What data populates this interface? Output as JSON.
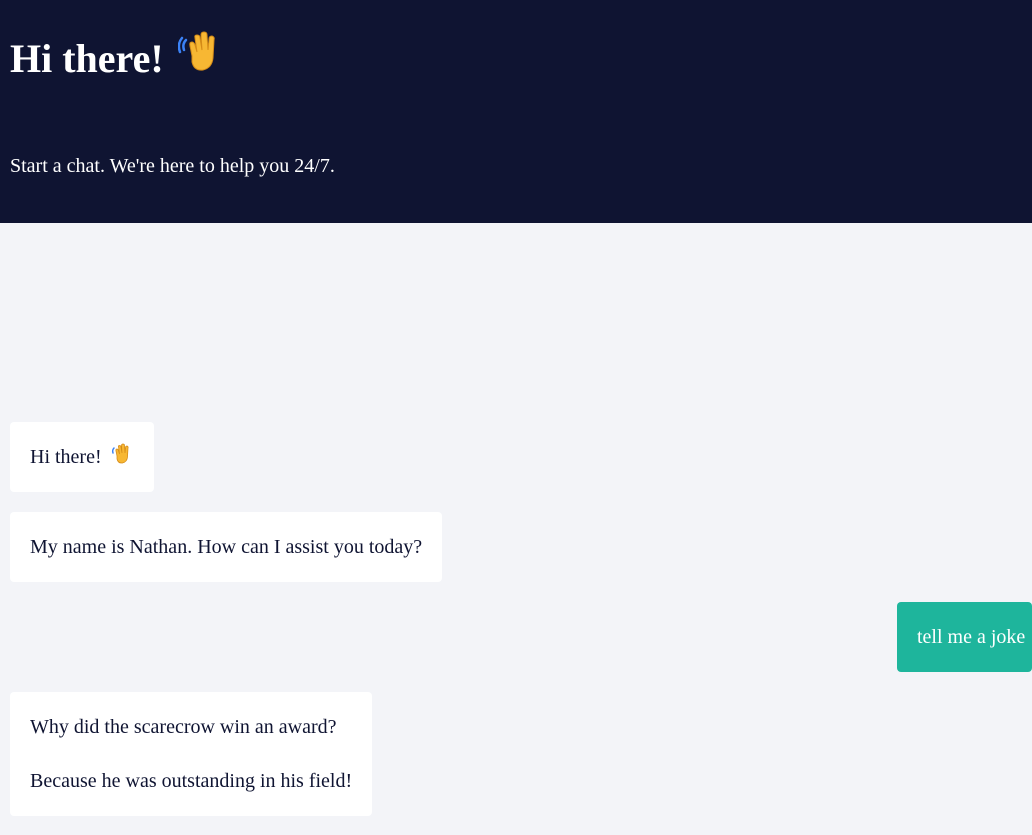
{
  "header": {
    "title": "Hi there!",
    "title_icon": "waving-hand-icon",
    "subtitle": "Start a chat. We're here to help you 24/7."
  },
  "messages": [
    {
      "sender": "bot",
      "text": "Hi there!",
      "icon": "waving-hand-icon"
    },
    {
      "sender": "bot",
      "text": "My name is Nathan. How can I assist you today?"
    },
    {
      "sender": "user",
      "text": "tell me a joke"
    },
    {
      "sender": "bot",
      "lines": [
        "Why did the scarecrow win an award?",
        "Because he was outstanding in his field!"
      ]
    }
  ],
  "colors": {
    "header_bg": "#0f1432",
    "chat_bg": "#f3f4f8",
    "bot_bubble": "#ffffff",
    "user_bubble": "#1eb59c"
  }
}
